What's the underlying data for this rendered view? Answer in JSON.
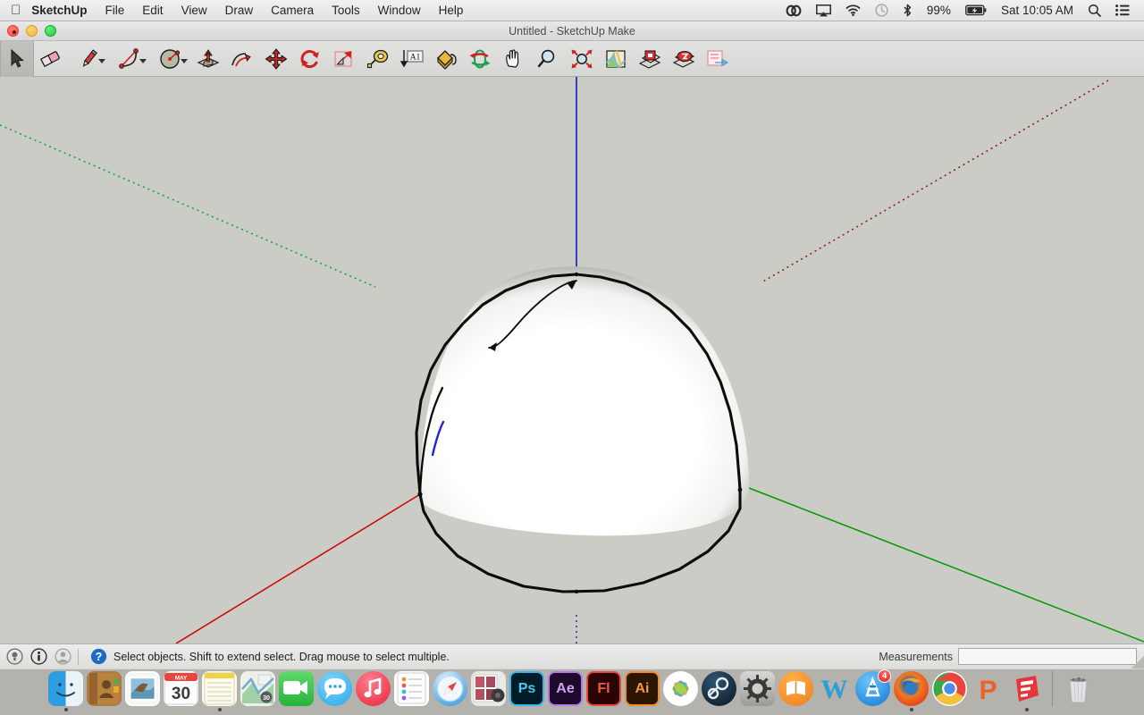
{
  "menubar": {
    "apple_icon": "apple-icon",
    "app_name": "SketchUp",
    "items": [
      "File",
      "Edit",
      "View",
      "Draw",
      "Camera",
      "Tools",
      "Window",
      "Help"
    ],
    "status": {
      "icons": [
        "creative-cloud-icon",
        "airplay-icon",
        "wifi-icon",
        "time-machine-icon",
        "bluetooth-icon"
      ],
      "battery_percent": "99%",
      "battery_icon": "battery-charging-icon",
      "clock": "Sat 10:05 AM",
      "search_icon": "spotlight-search-icon",
      "notification_icon": "notification-center-icon"
    }
  },
  "window": {
    "title": "Untitled - SketchUp Make",
    "close_label": "close-button",
    "minimize_label": "minimize-button",
    "zoom_label": "zoom-button"
  },
  "toolbar": {
    "tools": [
      {
        "name": "select-tool",
        "icon": "arrow-cursor-icon",
        "active": true,
        "menu": false
      },
      {
        "name": "eraser-tool",
        "icon": "eraser-icon",
        "active": false,
        "menu": false
      },
      {
        "name": "line-tool",
        "icon": "pencil-icon",
        "active": false,
        "menu": true
      },
      {
        "name": "arc-tool",
        "icon": "arc-icon",
        "active": false,
        "menu": true
      },
      {
        "name": "shapes-tool",
        "icon": "circle-icon",
        "active": false,
        "menu": true
      },
      {
        "name": "push-pull-tool",
        "icon": "push-pull-icon",
        "active": false,
        "menu": false
      },
      {
        "name": "follow-me-tool",
        "icon": "follow-me-icon",
        "active": false,
        "menu": false
      },
      {
        "name": "move-tool",
        "icon": "move-arrows-icon",
        "active": false,
        "menu": false
      },
      {
        "name": "rotate-tool",
        "icon": "rotate-icon",
        "active": false,
        "menu": false
      },
      {
        "name": "scale-tool",
        "icon": "scale-icon",
        "active": false,
        "menu": false
      },
      {
        "name": "tape-measure-tool",
        "icon": "tape-measure-icon",
        "active": false,
        "menu": false
      },
      {
        "name": "dimension-tool",
        "icon": "dimension-a1-icon",
        "active": false,
        "menu": false
      },
      {
        "name": "paint-bucket-tool",
        "icon": "paint-bucket-icon",
        "active": false,
        "menu": false
      },
      {
        "name": "orbit-tool",
        "icon": "orbit-icon",
        "active": false,
        "menu": false
      },
      {
        "name": "pan-tool",
        "icon": "pan-hand-icon",
        "active": false,
        "menu": false
      },
      {
        "name": "zoom-tool",
        "icon": "magnifier-icon",
        "active": false,
        "menu": false
      },
      {
        "name": "zoom-extents-tool",
        "icon": "zoom-extents-icon",
        "active": false,
        "menu": false
      },
      {
        "name": "add-location-tool",
        "icon": "map-location-icon",
        "active": false,
        "menu": false
      },
      {
        "name": "get-models-tool",
        "icon": "warehouse-get-icon",
        "active": false,
        "menu": false
      },
      {
        "name": "share-model-tool",
        "icon": "warehouse-share-icon",
        "active": false,
        "menu": false
      },
      {
        "name": "export-slide-tool",
        "icon": "layout-export-icon",
        "active": false,
        "menu": false
      }
    ]
  },
  "viewport": {
    "background_color": "#ccccc6",
    "model": "white-dome-hemisphere",
    "axes": {
      "red_axis_color": "#cc0000",
      "green_axis_color": "#009900",
      "blue_axis_color": "#2222cc",
      "negative_red_color": "#8b2020",
      "negative_green_color": "#11aa33",
      "negative_blue_color": "#5555bb"
    },
    "edge_color": "#000000",
    "face_color": "#ffffff",
    "guide_edge_color": "#2222dd"
  },
  "statusbar": {
    "icons": [
      "hint-bulb-icon",
      "info-icon",
      "account-person-icon"
    ],
    "help_icon": "help-question-icon",
    "message": "Select objects. Shift to extend select. Drag mouse to select multiple.",
    "measurements_label": "Measurements",
    "measurements_value": "",
    "measurements_placeholder": ""
  },
  "dock": {
    "items": [
      {
        "name": "dock-item-finder",
        "label": "Finder",
        "icon": "finder-icon",
        "running": true
      },
      {
        "name": "dock-item-contacts",
        "label": "Contacts",
        "icon": "contacts-icon",
        "running": false
      },
      {
        "name": "dock-item-mail",
        "label": "Mail",
        "icon": "mail-icon",
        "running": false
      },
      {
        "name": "dock-item-calendar",
        "label": "Calendar",
        "icon": "calendar-icon",
        "running": false,
        "month": "MAY",
        "day": "30"
      },
      {
        "name": "dock-item-notes",
        "label": "Notes",
        "icon": "notes-icon",
        "running": true
      },
      {
        "name": "dock-item-maps",
        "label": "Maps",
        "icon": "maps-icon",
        "running": false
      },
      {
        "name": "dock-item-facetime",
        "label": "FaceTime",
        "icon": "facetime-icon",
        "running": false
      },
      {
        "name": "dock-item-messages",
        "label": "Messages",
        "icon": "messages-icon",
        "running": false
      },
      {
        "name": "dock-item-itunes",
        "label": "iTunes",
        "icon": "itunes-icon",
        "running": false
      },
      {
        "name": "dock-item-reminders",
        "label": "Reminders",
        "icon": "reminders-icon",
        "running": false
      },
      {
        "name": "dock-item-safari",
        "label": "Safari",
        "icon": "safari-icon",
        "running": false
      },
      {
        "name": "dock-item-photo-booth",
        "label": "Photo Booth",
        "icon": "photo-booth-icon",
        "running": false
      },
      {
        "name": "dock-item-photoshop",
        "label": "Ps",
        "icon": "photoshop-icon",
        "running": false
      },
      {
        "name": "dock-item-after-effects",
        "label": "Ae",
        "icon": "after-effects-icon",
        "running": false
      },
      {
        "name": "dock-item-flash",
        "label": "Fl",
        "icon": "flash-icon",
        "running": false
      },
      {
        "name": "dock-item-illustrator",
        "label": "Ai",
        "icon": "illustrator-icon",
        "running": false
      },
      {
        "name": "dock-item-photos",
        "label": "Photos",
        "icon": "photos-icon",
        "running": false
      },
      {
        "name": "dock-item-steam",
        "label": "Steam",
        "icon": "steam-icon",
        "running": false
      },
      {
        "name": "dock-item-system-preferences",
        "label": "System Preferences",
        "icon": "system-prefs-icon",
        "running": false
      },
      {
        "name": "dock-item-ibooks",
        "label": "iBooks",
        "icon": "ibooks-icon",
        "running": false
      },
      {
        "name": "dock-item-word",
        "label": "W",
        "icon": "word-icon",
        "running": false
      },
      {
        "name": "dock-item-app-store",
        "label": "App Store",
        "icon": "app-store-icon",
        "running": false,
        "badge": "4"
      },
      {
        "name": "dock-item-firefox",
        "label": "Firefox",
        "icon": "firefox-icon",
        "running": true
      },
      {
        "name": "dock-item-chrome",
        "label": "Chrome",
        "icon": "chrome-icon",
        "running": false
      },
      {
        "name": "dock-item-p-app",
        "label": "P",
        "icon": "p-app-icon",
        "running": false
      },
      {
        "name": "dock-item-sketchup",
        "label": "SketchUp",
        "icon": "sketchup-icon",
        "running": true
      }
    ],
    "trash": {
      "name": "dock-item-trash",
      "label": "Trash",
      "icon": "trash-icon"
    }
  }
}
